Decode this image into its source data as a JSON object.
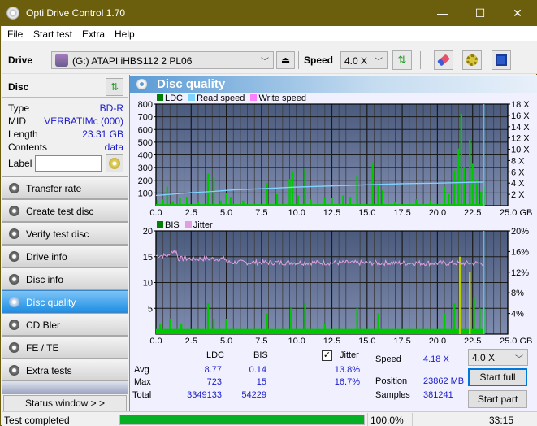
{
  "window": {
    "title": "Opti Drive Control 1.70",
    "minimize": "—",
    "maximize": "☐",
    "close": "✕"
  },
  "menu": [
    "File",
    "Start test",
    "Extra",
    "Help"
  ],
  "toolbar": {
    "drive_label": "Drive",
    "drive_value": "(G:)  ATAPI iHBS112  2 PL06",
    "eject_icon": "⏏",
    "speed_label": "Speed",
    "speed_value": "4.0 X",
    "refresh_icon": "⇅",
    "erase_icon": "eraser",
    "settings_icon": "gears",
    "save_icon": "floppy"
  },
  "disc": {
    "header": "Disc",
    "rows": [
      {
        "key": "Type",
        "value": "BD-R"
      },
      {
        "key": "MID",
        "value": "VERBATIMc (000)"
      },
      {
        "key": "Length",
        "value": "23.31 GB"
      },
      {
        "key": "Contents",
        "value": "data"
      }
    ],
    "label_key": "Label",
    "label_value": ""
  },
  "nav": [
    {
      "label": "Transfer rate",
      "active": false
    },
    {
      "label": "Create test disc",
      "active": false
    },
    {
      "label": "Verify test disc",
      "active": false
    },
    {
      "label": "Drive info",
      "active": false
    },
    {
      "label": "Disc info",
      "active": false
    },
    {
      "label": "Disc quality",
      "active": true
    },
    {
      "label": "CD Bler",
      "active": false
    },
    {
      "label": "FE / TE",
      "active": false
    },
    {
      "label": "Extra tests",
      "active": false
    }
  ],
  "status_window_button": "Status window > >",
  "panel": {
    "title": "Disc quality"
  },
  "chart_data": [
    {
      "type": "bar",
      "title": "LDC / Read speed",
      "legend": [
        "LDC",
        "Read speed",
        "Write speed"
      ],
      "colors": {
        "LDC": "#00c800",
        "Read speed": "#7fd4ff",
        "Write speed": "#ff80ff"
      },
      "xlabel": "GB",
      "xlim": [
        0,
        25
      ],
      "x_ticks": [
        "0.0",
        "2.5",
        "5.0",
        "7.5",
        "10.0",
        "12.5",
        "15.0",
        "17.5",
        "20.0",
        "22.5",
        "25.0 GB"
      ],
      "ylim_left": [
        0,
        800
      ],
      "y_ticks_left": [
        "800",
        "700",
        "600",
        "500",
        "400",
        "300",
        "200",
        "100"
      ],
      "ylim_right": [
        0,
        18
      ],
      "y_ticks_right": [
        "18 X",
        "16 X",
        "14 X",
        "12 X",
        "10 X",
        "8 X",
        "6 X",
        "4 X",
        "2 X"
      ],
      "ldc_peaks": [
        {
          "x": 0.1,
          "y": 45
        },
        {
          "x": 0.5,
          "y": 50
        },
        {
          "x": 0.8,
          "y": 150
        },
        {
          "x": 1.2,
          "y": 35
        },
        {
          "x": 1.7,
          "y": 60
        },
        {
          "x": 2.2,
          "y": 70
        },
        {
          "x": 3.0,
          "y": 30
        },
        {
          "x": 3.7,
          "y": 255
        },
        {
          "x": 4.1,
          "y": 220
        },
        {
          "x": 4.6,
          "y": 40
        },
        {
          "x": 5.0,
          "y": 100
        },
        {
          "x": 5.3,
          "y": 70
        },
        {
          "x": 6.2,
          "y": 40
        },
        {
          "x": 7.9,
          "y": 180
        },
        {
          "x": 8.6,
          "y": 90
        },
        {
          "x": 9.5,
          "y": 210
        },
        {
          "x": 9.7,
          "y": 275
        },
        {
          "x": 10.1,
          "y": 80
        },
        {
          "x": 10.6,
          "y": 290
        },
        {
          "x": 11.0,
          "y": 50
        },
        {
          "x": 12.0,
          "y": 60
        },
        {
          "x": 12.5,
          "y": 60
        },
        {
          "x": 13.3,
          "y": 80
        },
        {
          "x": 13.8,
          "y": 70
        },
        {
          "x": 14.3,
          "y": 240
        },
        {
          "x": 15.4,
          "y": 340
        },
        {
          "x": 15.8,
          "y": 180
        },
        {
          "x": 16.1,
          "y": 120
        },
        {
          "x": 17.0,
          "y": 30
        },
        {
          "x": 18.5,
          "y": 50
        },
        {
          "x": 19.5,
          "y": 40
        },
        {
          "x": 20.5,
          "y": 150
        },
        {
          "x": 20.8,
          "y": 90
        },
        {
          "x": 21.2,
          "y": 280
        },
        {
          "x": 21.5,
          "y": 450
        },
        {
          "x": 21.7,
          "y": 723
        },
        {
          "x": 21.9,
          "y": 300
        },
        {
          "x": 22.3,
          "y": 520
        },
        {
          "x": 22.5,
          "y": 330
        },
        {
          "x": 22.8,
          "y": 200
        },
        {
          "x": 23.1,
          "y": 110
        },
        {
          "x": 23.3,
          "y": 150
        }
      ],
      "read_speed": [
        {
          "x": 0.0,
          "y": 1.8
        },
        {
          "x": 1.0,
          "y": 2.0
        },
        {
          "x": 2.5,
          "y": 2.3
        },
        {
          "x": 4.0,
          "y": 2.5
        },
        {
          "x": 5.5,
          "y": 2.8
        },
        {
          "x": 7.5,
          "y": 3.0
        },
        {
          "x": 10.0,
          "y": 3.3
        },
        {
          "x": 12.5,
          "y": 3.5
        },
        {
          "x": 15.0,
          "y": 3.7
        },
        {
          "x": 17.5,
          "y": 3.9
        },
        {
          "x": 20.0,
          "y": 4.0
        },
        {
          "x": 22.5,
          "y": 4.15
        },
        {
          "x": 23.31,
          "y": 4.18
        }
      ],
      "end_marker_x": 23.31
    },
    {
      "type": "bar",
      "title": "BIS / Jitter",
      "legend": [
        "BIS",
        "Jitter"
      ],
      "colors": {
        "BIS": "#00c800",
        "Jitter": "#e0a0e0"
      },
      "xlabel": "GB",
      "xlim": [
        0,
        25
      ],
      "x_ticks": [
        "0.0",
        "2.5",
        "5.0",
        "7.5",
        "10.0",
        "12.5",
        "15.0",
        "17.5",
        "20.0",
        "22.5",
        "25.0 GB"
      ],
      "ylim_left": [
        0,
        20
      ],
      "y_ticks_left": [
        "20",
        "15",
        "10",
        "5"
      ],
      "ylim_right": [
        0,
        20
      ],
      "y_ticks_right": [
        "20%",
        "16%",
        "12%",
        "8%",
        "4%"
      ],
      "bis_peaks": [
        {
          "x": 0.3,
          "y": 2
        },
        {
          "x": 1.0,
          "y": 3
        },
        {
          "x": 1.8,
          "y": 2
        },
        {
          "x": 3.7,
          "y": 6
        },
        {
          "x": 4.1,
          "y": 3
        },
        {
          "x": 5.0,
          "y": 3
        },
        {
          "x": 7.9,
          "y": 4
        },
        {
          "x": 9.6,
          "y": 5
        },
        {
          "x": 10.6,
          "y": 6
        },
        {
          "x": 12.0,
          "y": 2
        },
        {
          "x": 14.3,
          "y": 5
        },
        {
          "x": 15.8,
          "y": 4
        },
        {
          "x": 20.5,
          "y": 4
        },
        {
          "x": 21.2,
          "y": 6
        },
        {
          "x": 21.6,
          "y": 15
        },
        {
          "x": 22.3,
          "y": 12
        },
        {
          "x": 22.6,
          "y": 7
        },
        {
          "x": 23.0,
          "y": 5
        },
        {
          "x": 23.3,
          "y": 5
        }
      ],
      "jitter_avg_pct": 13.8,
      "jitter_start_pct": 15.2,
      "end_marker_x": 23.31
    }
  ],
  "stats": {
    "col_ldc": "LDC",
    "col_bis": "BIS",
    "jitter_label": "Jitter",
    "jitter_checked": true,
    "rows": [
      {
        "label": "Avg",
        "ldc": "8.77",
        "bis": "0.14",
        "jitter": "13.8%"
      },
      {
        "label": "Max",
        "ldc": "723",
        "bis": "15",
        "jitter": "16.7%"
      },
      {
        "label": "Total",
        "ldc": "3349133",
        "bis": "54229",
        "jitter": ""
      }
    ],
    "speed_label": "Speed",
    "speed_value": "4.18 X",
    "position_label": "Position",
    "position_value": "23862 MB",
    "samples_label": "Samples",
    "samples_value": "381241",
    "speed_select": "4.0 X",
    "start_full": "Start full",
    "start_part": "Start part"
  },
  "statusbar": {
    "text": "Test completed",
    "progress": 100,
    "progress_text": "100.0%",
    "time": "33:15"
  }
}
